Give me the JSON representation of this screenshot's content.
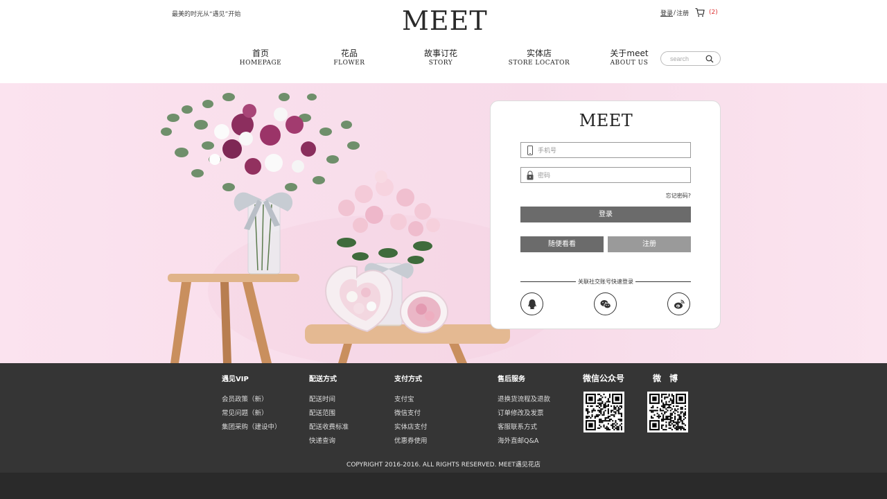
{
  "header": {
    "tagline": "最美的时光从“遇见”开始",
    "logo": "MEET",
    "login_link": "登录",
    "separator": "/",
    "register_link": "注册",
    "cart_count": "(2)"
  },
  "nav": [
    {
      "cn": "首页",
      "en": "HOMEPAGE"
    },
    {
      "cn": "花品",
      "en": "FLOWER"
    },
    {
      "cn": "故事订花",
      "en": "STORY"
    },
    {
      "cn": "实体店",
      "en": "STORE LOCATOR"
    },
    {
      "cn": "关于meet",
      "en": "ABOUT US"
    }
  ],
  "search": {
    "placeholder": "search"
  },
  "login": {
    "logo": "MEET",
    "phone_placeholder": "手机号",
    "password_placeholder": "密码",
    "forgot": "忘记密码?",
    "login_button": "登录",
    "browse_button": "随便看看",
    "register_button": "注册",
    "social_label": "关联社交账号快速登录",
    "social_icons": [
      "qq-icon",
      "wechat-icon",
      "weibo-icon"
    ]
  },
  "footer": {
    "columns": [
      {
        "title": "遇见VIP",
        "items": [
          "会员政策（新）",
          "常见问题（新）",
          "集团采购（建设中）"
        ]
      },
      {
        "title": "配送方式",
        "items": [
          "配送时间",
          "配送范围",
          "配送收费标准",
          "快递查询"
        ]
      },
      {
        "title": "支付方式",
        "items": [
          "支付宝",
          "微信支付",
          "实体店支付",
          "优惠券使用"
        ]
      },
      {
        "title": "售后服务",
        "items": [
          "退换货流程及退款",
          "订单修改及发票",
          "客服联系方式",
          "海外直邮Q&A"
        ]
      }
    ],
    "wechat_title": "微信公众号",
    "weibo_title": "微　博",
    "copyright": "COPYRIGHT 2016-2016. ALL RIGHTS RESERVED. MEET遇见花店"
  },
  "colors": {
    "hero_bg": "#f9dfec",
    "button_dark": "#6b6b6b",
    "button_light": "#9a9a9a",
    "footer_bg": "#353535",
    "cart_count": "#dd3333"
  }
}
